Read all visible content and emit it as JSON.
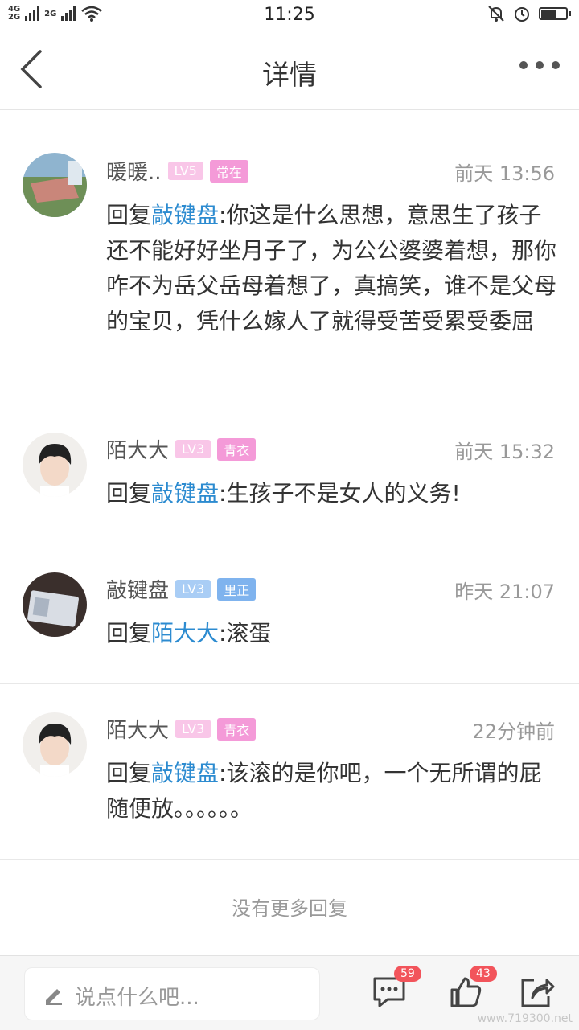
{
  "status_bar": {
    "net_top": "4G",
    "net_bottom": "2G",
    "net2": "2G",
    "time": "11:25",
    "battery_level": 0.55
  },
  "header": {
    "title": "详情"
  },
  "comments": [
    {
      "name": "暖暖..",
      "level": "LV5",
      "tag": "常在",
      "time": "前天 13:56",
      "reply_word": "回复",
      "mention": "敲键盘",
      "text": ":你这是什么思想，意思生了孩子还不能好好坐月子了，为公公婆婆着想，那你咋不为岳父岳母着想了，真搞笑，谁不是父母的宝贝，凭什么嫁人了就得受苦受累受委屈"
    },
    {
      "name": "陌大大",
      "level": "LV3",
      "tag": "青衣",
      "time": "前天 15:32",
      "reply_word": "回复",
      "mention": "敲键盘",
      "text": ":生孩子不是女人的义务!"
    },
    {
      "name": "敲键盘",
      "level": "LV3",
      "tag": "里正",
      "time": "昨天 21:07",
      "reply_word": "回复",
      "mention": "陌大大",
      "text": ":滚蛋"
    },
    {
      "name": "陌大大",
      "level": "LV3",
      "tag": "青衣",
      "time": "22分钟前",
      "reply_word": "回复",
      "mention": "敲键盘",
      "text": ":该滚的是你吧，一个无所谓的屁随便放。。。。。。"
    }
  ],
  "footer_text": "没有更多回复",
  "bottom_bar": {
    "input_placeholder": "说点什么吧...",
    "comment_count": "59",
    "like_count": "43"
  },
  "watermark": "www.719300.net"
}
